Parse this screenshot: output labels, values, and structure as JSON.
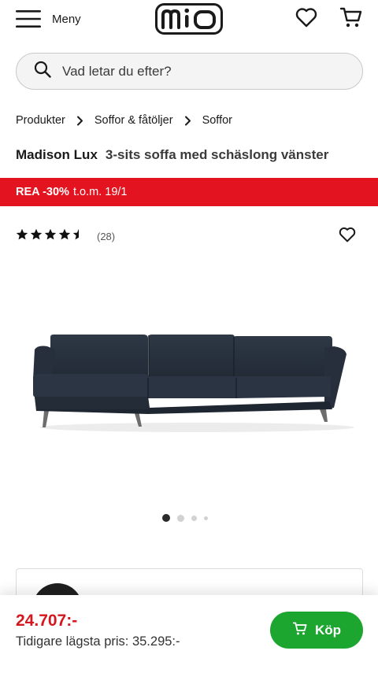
{
  "header": {
    "menu_label": "Meny",
    "logo_text": "mio",
    "icons": [
      "menu-icon",
      "heart-icon",
      "cart-icon"
    ]
  },
  "search": {
    "placeholder": "Vad letar du efter?",
    "value": ""
  },
  "breadcrumb": [
    "Produkter",
    "Soffor & fåtöljer",
    "Soffor"
  ],
  "product": {
    "brand": "Madison Lux",
    "description": "3-sits soffa med schäslong vänster",
    "rating": 4.5,
    "rating_max": 5,
    "review_count": "(28)",
    "image_count": 4,
    "active_image": 1
  },
  "promo": {
    "discount": "REA -30%",
    "until": "t.o.m. 19/1"
  },
  "price": {
    "current": "24.707:-",
    "previous": "Tidigare lägsta pris: 35.295:-"
  },
  "buy_button": {
    "label": "Köp"
  },
  "colors": {
    "sale_red": "#e3141f",
    "price_red": "#d6161f",
    "buy_green": "#1ca52f",
    "sofa_navy": "#26303d"
  }
}
